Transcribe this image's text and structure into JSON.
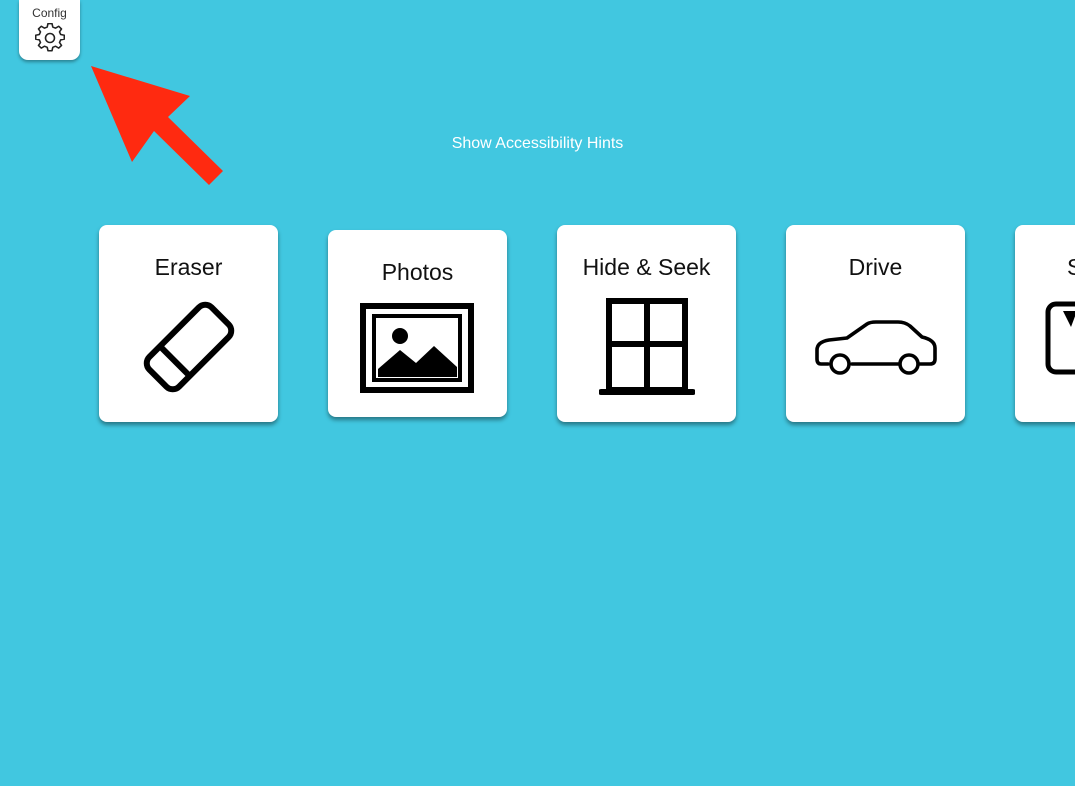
{
  "colors": {
    "background": "#41c7e0",
    "card": "#ffffff",
    "arrow": "#ff2a10",
    "icon": "#000000"
  },
  "config": {
    "label": "Config",
    "icon": "gear-icon"
  },
  "hints": {
    "label": "Show Accessibility Hints"
  },
  "cards": [
    {
      "title": "Eraser",
      "icon": "eraser-icon"
    },
    {
      "title": "Photos",
      "icon": "photo-icon"
    },
    {
      "title": "Hide & Seek",
      "icon": "window-icon"
    },
    {
      "title": "Drive",
      "icon": "car-icon"
    },
    {
      "title": "S",
      "icon": "partial-icon"
    }
  ]
}
